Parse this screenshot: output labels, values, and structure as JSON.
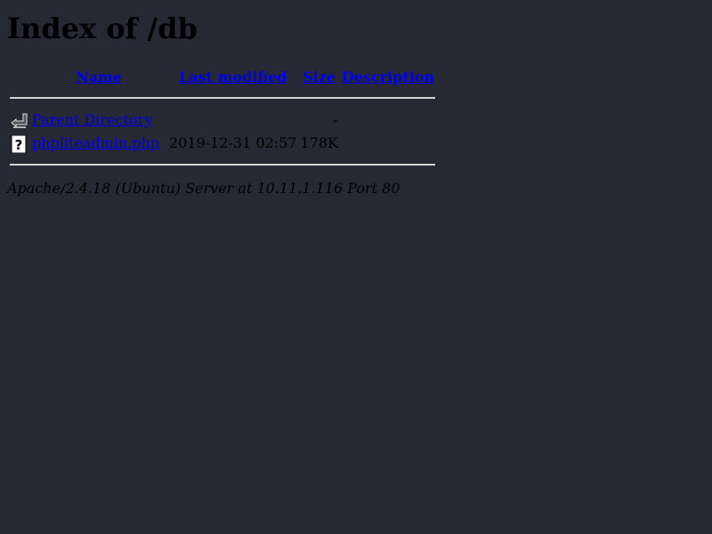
{
  "page": {
    "title": "Index of /db"
  },
  "table": {
    "headers": {
      "name": "Name",
      "last_modified": "Last modified",
      "size": "Size",
      "description": "Description"
    },
    "rows": [
      {
        "icon": "back-icon",
        "name": "Parent Directory",
        "last_modified": "",
        "size": "-",
        "description": ""
      },
      {
        "icon": "unknown-file-icon",
        "name": "phpliteadmin.php",
        "last_modified": "2019-12-31 02:57",
        "size": "178K",
        "description": ""
      }
    ]
  },
  "footer": {
    "address": "Apache/2.4.18 (Ubuntu) Server at 10.11.1.116 Port 80"
  },
  "colors": {
    "background": "#262833",
    "text": "#000000",
    "link": "#0000ee",
    "rule": "#d4d4d4"
  }
}
